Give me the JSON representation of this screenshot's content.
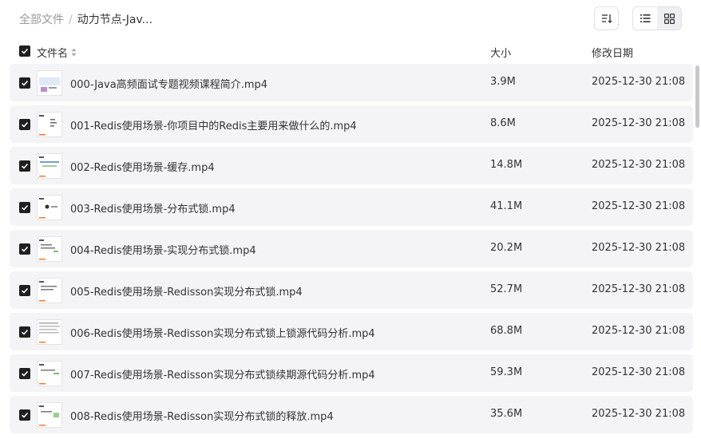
{
  "breadcrumb": {
    "root": "全部文件",
    "separator": "/",
    "current": "动力节点-Jav..."
  },
  "columns": {
    "name": "文件名",
    "size": "大小",
    "date": "修改日期"
  },
  "files": [
    {
      "name": "000-Java高频面试专题视频课程简介.mp4",
      "size": "3.9M",
      "date": "2025-12-30 21:08",
      "checked": true
    },
    {
      "name": "001-Redis使用场景-你项目中的Redis主要用来做什么的.mp4",
      "size": "8.6M",
      "date": "2025-12-30 21:08",
      "checked": true
    },
    {
      "name": "002-Redis使用场景-缓存.mp4",
      "size": "14.8M",
      "date": "2025-12-30 21:08",
      "checked": true
    },
    {
      "name": "003-Redis使用场景-分布式锁.mp4",
      "size": "41.1M",
      "date": "2025-12-30 21:08",
      "checked": true
    },
    {
      "name": "004-Redis使用场景-实现分布式锁.mp4",
      "size": "20.2M",
      "date": "2025-12-30 21:08",
      "checked": true
    },
    {
      "name": "005-Redis使用场景-Redisson实现分布式锁.mp4",
      "size": "52.7M",
      "date": "2025-12-30 21:08",
      "checked": true
    },
    {
      "name": "006-Redis使用场景-Redisson实现分布式锁上锁源代码分析.mp4",
      "size": "68.8M",
      "date": "2025-12-30 21:08",
      "checked": true
    },
    {
      "name": "007-Redis使用场景-Redisson实现分布式锁续期源代码分析.mp4",
      "size": "59.3M",
      "date": "2025-12-30 21:08",
      "checked": true
    },
    {
      "name": "008-Redis使用场景-Redisson实现分布式锁的释放.mp4",
      "size": "35.6M",
      "date": "2025-12-30 21:08",
      "checked": true
    }
  ],
  "icons": {
    "sort": "sort-icon",
    "list_view": "list-view-icon",
    "grid_view": "grid-view-icon",
    "checkbox": "checkmark-icon",
    "sort_column": "sort-arrows-icon"
  },
  "colors": {
    "row_bg": "#f4f4f6",
    "checkbox": "#1f1f1f",
    "muted_text": "#999999",
    "thumb_accent": "#f07a2c"
  },
  "view_mode": "list"
}
